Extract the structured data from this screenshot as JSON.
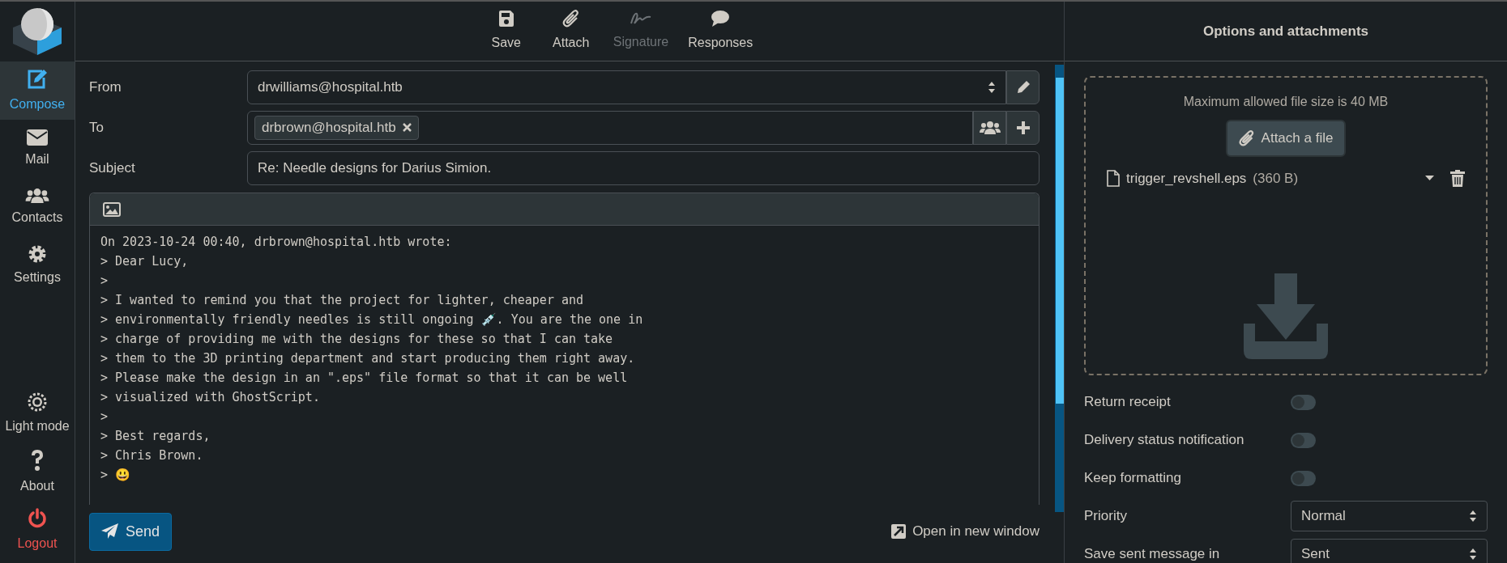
{
  "sidebar": {
    "items": [
      {
        "label": "Compose",
        "selected": true
      },
      {
        "label": "Mail",
        "selected": false
      },
      {
        "label": "Contacts",
        "selected": false
      },
      {
        "label": "Settings",
        "selected": false
      }
    ],
    "bottom_items": [
      {
        "label": "Light mode",
        "kind": "normal"
      },
      {
        "label": "About",
        "kind": "normal"
      },
      {
        "label": "Logout",
        "kind": "danger"
      }
    ]
  },
  "toolbar": [
    {
      "label": "Save",
      "disabled": false
    },
    {
      "label": "Attach",
      "disabled": false
    },
    {
      "label": "Signature",
      "disabled": true
    },
    {
      "label": "Responses",
      "disabled": false
    }
  ],
  "compose": {
    "from": {
      "label": "From",
      "value": "drwilliams@hospital.htb"
    },
    "to": {
      "label": "To",
      "recipients": [
        "drbrown@hospital.htb"
      ]
    },
    "subject": {
      "label": "Subject",
      "value": "Re: Needle designs for Darius Simion."
    },
    "body": [
      "On 2023-10-24 00:40, drbrown@hospital.htb wrote:",
      "> Dear Lucy,",
      ">",
      "> I wanted to remind you that the project for lighter, cheaper and",
      "> environmentally friendly needles is still ongoing 💉. You are the one in",
      "> charge of providing me with the designs for these so that I can take",
      "> them to the 3D printing department and start producing them right away.",
      "> Please make the design in an \".eps\" file format so that it can be well",
      "> visualized with GhostScript.",
      ">",
      "> Best regards,",
      "> Chris Brown.",
      "> 😃"
    ],
    "send": "Send",
    "open_new_window": "Open in new window"
  },
  "options_panel": {
    "title": "Options and attachments",
    "max_size": "Maximum allowed file size is 40 MB",
    "attach_button": "Attach a file",
    "attachments": [
      {
        "name": "trigger_revshell.eps",
        "size": "(360 B)"
      }
    ],
    "options": [
      {
        "kind": "toggle",
        "label": "Return receipt",
        "on": false
      },
      {
        "kind": "toggle",
        "label": "Delivery status notification",
        "on": false
      },
      {
        "kind": "toggle",
        "label": "Keep formatting",
        "on": false
      },
      {
        "kind": "select",
        "label": "Priority",
        "value": "Normal"
      },
      {
        "kind": "select",
        "label": "Save sent message in",
        "value": "Sent"
      }
    ]
  }
}
